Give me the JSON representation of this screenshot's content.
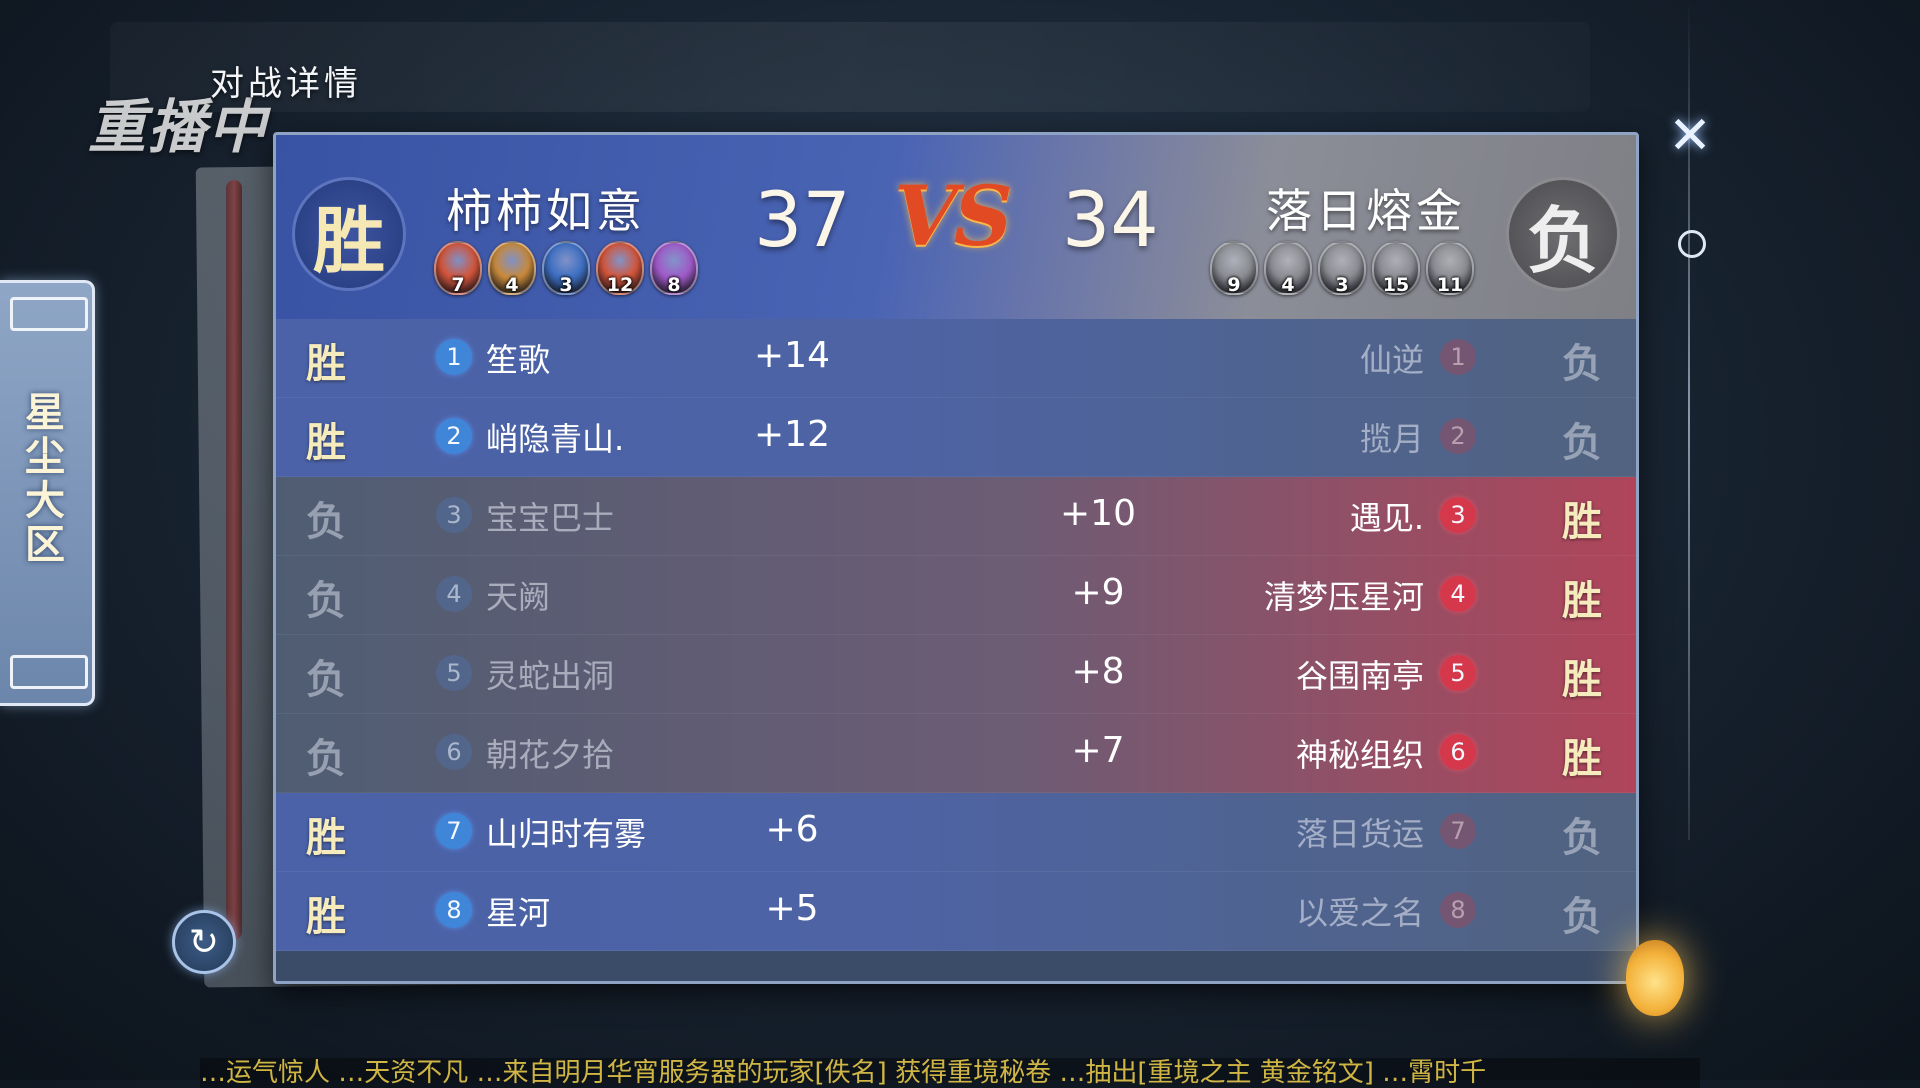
{
  "page": {
    "title": "对战详情",
    "replay_badge": "重播中",
    "region_label": "星尘大区"
  },
  "match": {
    "left": {
      "result": "胜",
      "name": "柿柿如意",
      "score": "37",
      "badges": [
        {
          "num": "7",
          "color": "#d4553a"
        },
        {
          "num": "4",
          "color": "#c98a3a"
        },
        {
          "num": "3",
          "color": "#3d6fc2"
        },
        {
          "num": "12",
          "color": "#d4553a"
        },
        {
          "num": "8",
          "color": "#a05ac8"
        }
      ]
    },
    "right": {
      "result": "负",
      "name": "落日熔金",
      "score": "34",
      "badges": [
        {
          "num": "9",
          "color": "#8a8c92"
        },
        {
          "num": "4",
          "color": "#8a8c92"
        },
        {
          "num": "3",
          "color": "#8a8c92"
        },
        {
          "num": "15",
          "color": "#8a8c92"
        },
        {
          "num": "11",
          "color": "#8a8c92"
        }
      ]
    },
    "vs_label": "VS"
  },
  "rows": [
    {
      "rank": "1",
      "left_mark": "胜",
      "left_name": "笙歌",
      "left_delta": "+14",
      "right_delta": "",
      "right_name": "仙逆",
      "right_mark": "负",
      "winner": "left"
    },
    {
      "rank": "2",
      "left_mark": "胜",
      "left_name": "峭隐青山.",
      "left_delta": "+12",
      "right_delta": "",
      "right_name": "揽月",
      "right_mark": "负",
      "winner": "left"
    },
    {
      "rank": "3",
      "left_mark": "负",
      "left_name": "宝宝巴士",
      "left_delta": "",
      "right_delta": "+10",
      "right_name": "遇见.",
      "right_mark": "胜",
      "winner": "right"
    },
    {
      "rank": "4",
      "left_mark": "负",
      "left_name": "天阙",
      "left_delta": "",
      "right_delta": "+9",
      "right_name": "清梦压星河",
      "right_mark": "胜",
      "winner": "right"
    },
    {
      "rank": "5",
      "left_mark": "负",
      "left_name": "灵蛇出洞",
      "left_delta": "",
      "right_delta": "+8",
      "right_name": "谷围南亭",
      "right_mark": "胜",
      "winner": "right"
    },
    {
      "rank": "6",
      "left_mark": "负",
      "left_name": "朝花夕拾",
      "left_delta": "",
      "right_delta": "+7",
      "right_name": "神秘组织",
      "right_mark": "胜",
      "winner": "right"
    },
    {
      "rank": "7",
      "left_mark": "胜",
      "left_name": "山归时有雾",
      "left_delta": "+6",
      "right_delta": "",
      "right_name": "落日货运",
      "right_mark": "负",
      "winner": "left"
    },
    {
      "rank": "8",
      "left_mark": "胜",
      "left_name": "星河",
      "left_delta": "+5",
      "right_delta": "",
      "right_name": "以爱之名",
      "right_mark": "负",
      "winner": "left"
    }
  ],
  "controls": {
    "close_label": "✕",
    "refresh_label": "↻"
  },
  "ticker": "…运气惊人 …天资不凡 …来自明月华宵服务器的玩家[佚名] 获得重境秘卷 …抽出[重境之主 黄金铭文] …霄时千"
}
